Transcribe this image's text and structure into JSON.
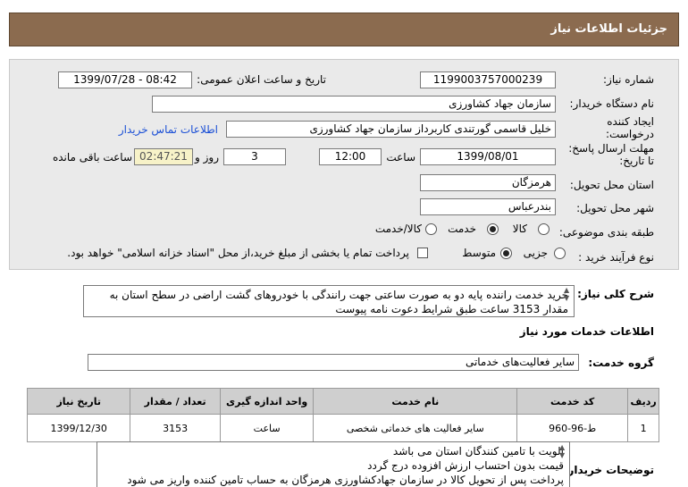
{
  "header": {
    "title": "جزئیات اطلاعات نیاز"
  },
  "form": {
    "need_number": {
      "label": "شماره نیاز:",
      "value": "1199003757000239"
    },
    "announce_datetime": {
      "label": "تاریخ و ساعت اعلان عمومی:",
      "value": "1399/07/28 - 08:42"
    },
    "buyer_org": {
      "label": "نام دستگاه خریدار:",
      "value": "سازمان جهاد کشاورزی"
    },
    "requester": {
      "label_line1": "ایجاد کننده",
      "label_line2": "درخواست:",
      "value": "خلیل قاسمی گورتندی کاربرداز سازمان جهاد کشاورزی",
      "contact_link": "اطلاعات تماس خریدار"
    },
    "deadline": {
      "label_line1": "مهلت ارسال پاسخ:",
      "label_line2": "تا تاریخ:",
      "date": "1399/08/01",
      "time_label": "ساعت",
      "time": "12:00",
      "days_value": "3",
      "days_label": "روز و",
      "remaining_time": "02:47:21",
      "remaining_label": "ساعت باقی مانده"
    },
    "province": {
      "label": "استان محل تحویل:",
      "value": "هرمزگان"
    },
    "city": {
      "label": "شهر محل تحویل:",
      "value": "بندرعباس"
    },
    "category": {
      "label": "طبقه بندی موضوعی:",
      "options": [
        "کالا",
        "خدمت",
        "کالا/خدمت"
      ],
      "selected": "خدمت"
    },
    "purchase_type": {
      "label": "نوع فرآیند خرید :",
      "options": [
        "جزیی",
        "متوسط"
      ],
      "selected": "متوسط",
      "checkbox_text": "پرداخت تمام یا بخشی از مبلغ خرید،از محل \"اسناد خزانه اسلامی\" خواهد بود."
    }
  },
  "summary": {
    "label": "شرح کلی نیاز:",
    "text": "خرید خدمت راننده پایه دو به صورت ساعتی  جهت رانندگی با خودروهای گشت اراضی در سطح استان به مقدار 3153 ساعت طبق شرایط دعوت نامه پیوست"
  },
  "services": {
    "section_title": "اطلاعات خدمات مورد نیاز",
    "group_label": "گروه خدمت:",
    "group_value": "سایر فعالیت‌های خدماتی",
    "columns": [
      "ردیف",
      "کد خدمت",
      "نام خدمت",
      "واحد اندازه گیری",
      "تعداد / مقدار",
      "تاریخ نیاز"
    ],
    "rows": [
      [
        "1",
        "ط-96-960",
        "سایر فعالیت های خدماتی شخصی",
        "ساعت",
        "3153",
        "1399/12/30"
      ]
    ]
  },
  "buyer_notes": {
    "label": "توضیحات خریدار:",
    "lines": [
      "الویت با تامین کنندگان استان می باشد",
      "قیمت بدون احتساب ارزش افزوده درج گردد",
      "پرداخت پس از تحویل کالا در سازمان جهادکشاورزی هرمزگان  به حساب تامین کننده واریز می شود"
    ]
  }
}
